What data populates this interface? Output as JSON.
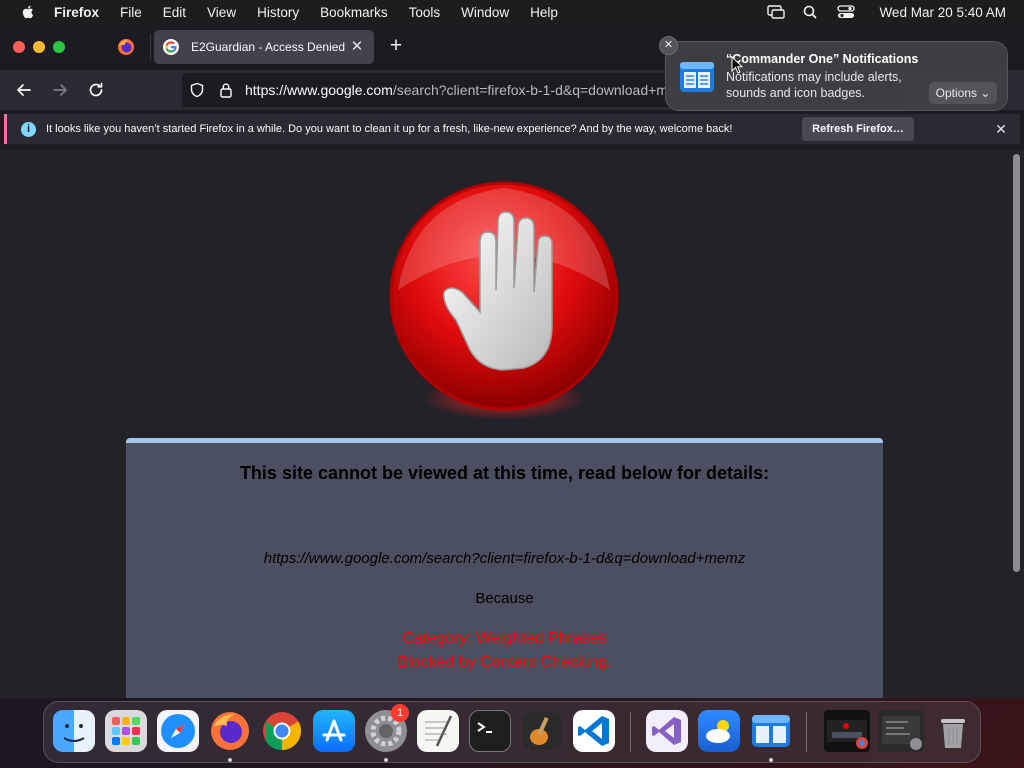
{
  "menubar": {
    "app_name": "Firefox",
    "items": [
      "File",
      "Edit",
      "View",
      "History",
      "Bookmarks",
      "Tools",
      "Window",
      "Help"
    ],
    "clock": "Wed Mar 20  5:40 AM"
  },
  "browser": {
    "tab_title": "E2Guardian - Access Denied",
    "url_domain": "https://www.google.com",
    "url_rest": "/search?client=firefox-b-1-d&q=download+memz"
  },
  "infobar": {
    "message": "It looks like you haven’t started Firefox in a while. Do you want to clean it up for a fresh, like-new experience? And by the way, welcome back!",
    "button_label": "Refresh Firefox…"
  },
  "page": {
    "heading": "This site cannot be viewed at this time, read below for details:",
    "blocked_url": "https://www.google.com/search?client=firefox-b-1-d&q=download+memz",
    "because": "Because",
    "reason_line1": "Category: Weighted Phrases",
    "reason_line2": "Blocked by Content Checking."
  },
  "notification": {
    "title": "“Commander One” Notifications",
    "body": "Notifications may include alerts, sounds and icon badges.",
    "options_label": "Options"
  },
  "dock": {
    "settings_badge": "1"
  },
  "colors": {
    "reason_text": "#ff0000",
    "panel_background": "#4a5060",
    "panel_border": "#a7c6e8",
    "infobar_accent": "#ff6f9b"
  }
}
